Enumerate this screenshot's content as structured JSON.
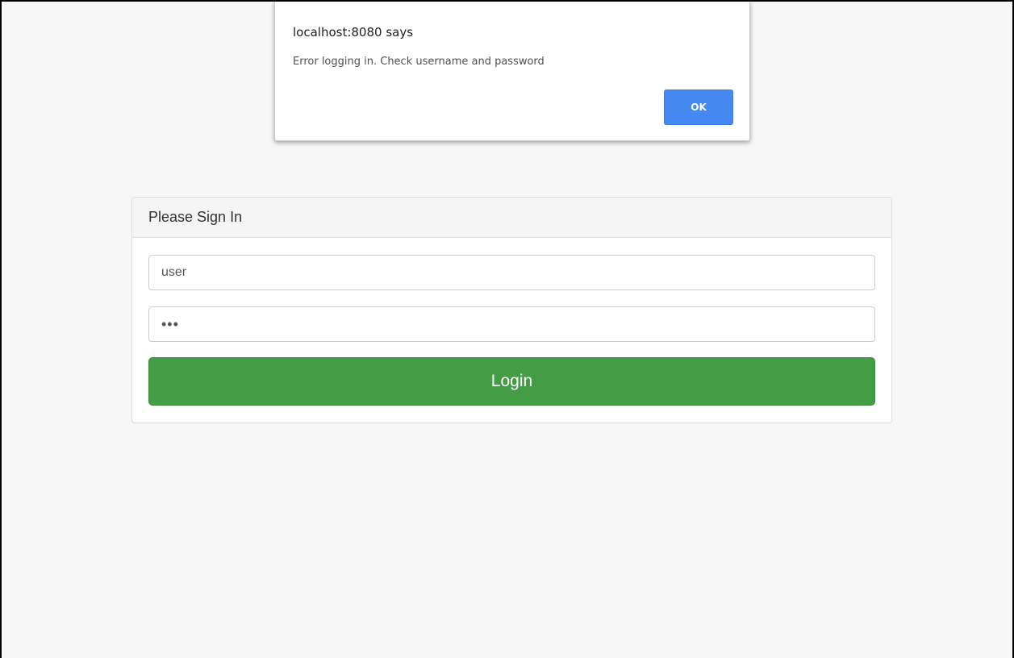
{
  "alert": {
    "title": "localhost:8080 says",
    "message": "Error logging in. Check username and password",
    "ok_label": "OK",
    "ok_color": "#4688f1"
  },
  "login": {
    "heading": "Please Sign In",
    "username_value": "user",
    "password_value": "•••",
    "button_label": "Login",
    "button_color": "#449d44"
  }
}
